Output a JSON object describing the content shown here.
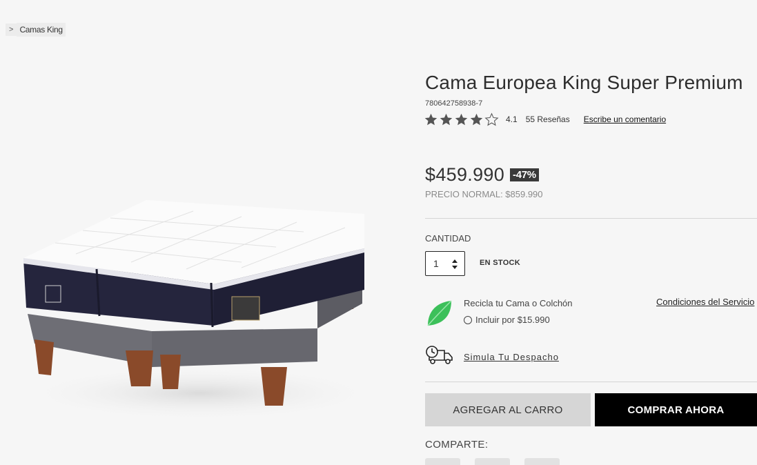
{
  "breadcrumb": {
    "separator": ">",
    "current": "Camas King"
  },
  "product": {
    "title": "Cama Europea King Super Premium",
    "sku": "780642758938-7",
    "rating_value": 4.1,
    "rating_text": "4.1",
    "reviews_text": "55 Reseñas",
    "write_review": "Escribe un comentario",
    "price": "$459.990",
    "discount_badge": "-47%",
    "normal_price": "PRECIO NORMAL: $859.990"
  },
  "purchase": {
    "quantity_label": "CANTIDAD",
    "quantity_value": "1",
    "stock_text": "EN STOCK",
    "recycle_title": "Recicla tu Cama o Colchón",
    "recycle_option": "Incluir por $15.990",
    "conditions_link": "Condiciones del Servicio",
    "simulate_link": "Simula Tu Despacho",
    "add_to_cart": "AGREGAR AL CARRO",
    "buy_now": "COMPRAR AHORA",
    "share_label": "COMPARTE:"
  },
  "icons": {
    "star": "star-icon",
    "recycle": "leaf-icon",
    "delivery": "truck-clock-icon"
  },
  "colors": {
    "background": "#f6f6f6",
    "buy_button": "#000000",
    "cart_button": "#d6d6d6",
    "badge": "#3a3a3a",
    "leaf": "#3cc05a"
  }
}
